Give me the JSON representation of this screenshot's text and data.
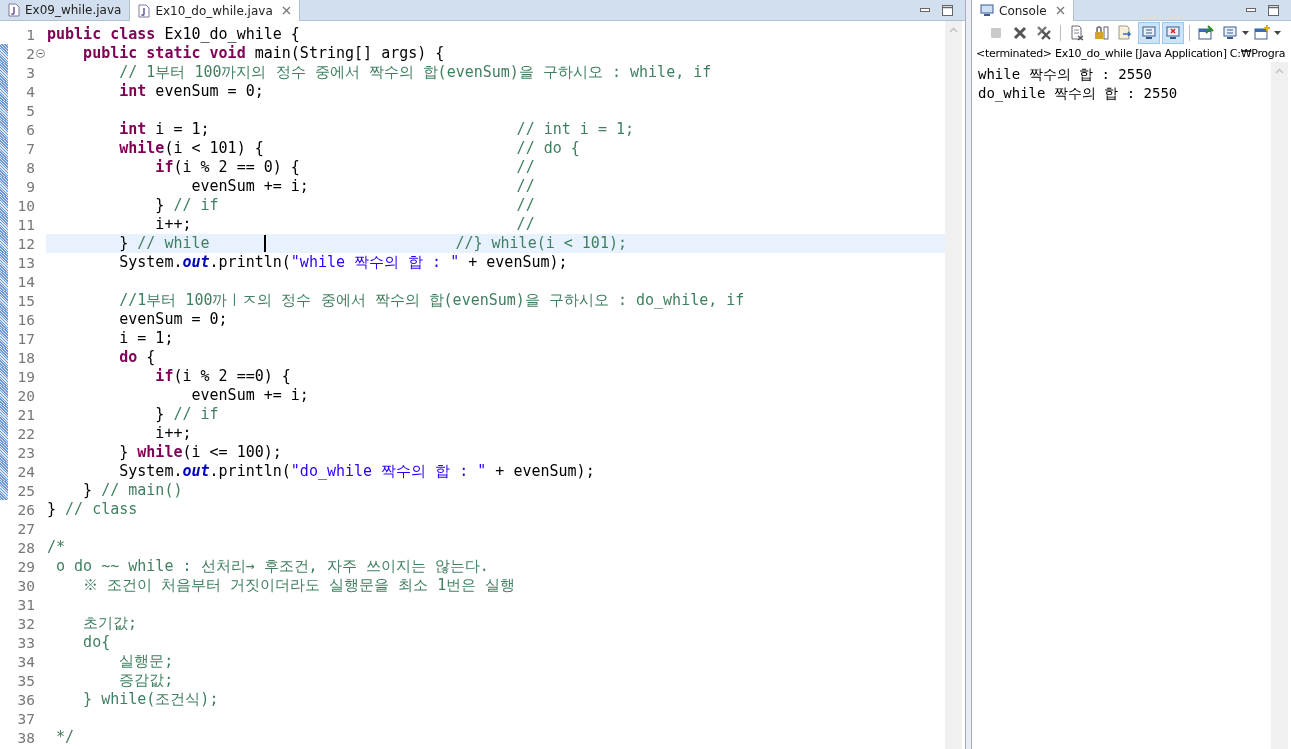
{
  "editor": {
    "tabs": [
      {
        "label": "Ex09_while.java",
        "selected": false,
        "closable": false
      },
      {
        "label": "Ex10_do_while.java",
        "selected": true,
        "closable": true
      }
    ],
    "lines": [
      {
        "number": "1",
        "changed": false,
        "current": false,
        "segments": [
          {
            "kind": "kw",
            "text": "public class"
          },
          {
            "kind": "plain",
            "text": " Ex10_do_while {"
          }
        ]
      },
      {
        "number": "2",
        "changed": true,
        "current": false,
        "foldable": true,
        "segments": [
          {
            "kind": "kw",
            "text": "    public static void"
          },
          {
            "kind": "plain",
            "text": " main(String[] args) {"
          }
        ]
      },
      {
        "number": "3",
        "changed": true,
        "current": false,
        "segments": [
          {
            "kind": "comment",
            "text": "        // 1부터 100까지의 정수 중에서 짝수의 합(evenSum)을 구하시오 : while, if"
          }
        ]
      },
      {
        "number": "4",
        "changed": true,
        "current": false,
        "segments": [
          {
            "kind": "kw",
            "text": "        int"
          },
          {
            "kind": "plain",
            "text": " evenSum = 0;"
          }
        ]
      },
      {
        "number": "5",
        "changed": true,
        "current": false
      },
      {
        "number": "6",
        "changed": true,
        "current": false,
        "segments": [
          {
            "kind": "kw",
            "text": "        int"
          },
          {
            "kind": "plain",
            "text": " i = 1;                                  "
          },
          {
            "kind": "comment",
            "text": "// int i = 1;"
          }
        ]
      },
      {
        "number": "7",
        "changed": true,
        "current": false,
        "segments": [
          {
            "kind": "kw",
            "text": "        while"
          },
          {
            "kind": "plain",
            "text": "(i < 101) {                            "
          },
          {
            "kind": "comment",
            "text": "// do {"
          }
        ]
      },
      {
        "number": "8",
        "changed": true,
        "current": false,
        "segments": [
          {
            "kind": "kw",
            "text": "            if"
          },
          {
            "kind": "plain",
            "text": "(i % 2 == 0) {                        "
          },
          {
            "kind": "comment",
            "text": "//"
          }
        ]
      },
      {
        "number": "9",
        "changed": true,
        "current": false,
        "segments": [
          {
            "kind": "plain",
            "text": "                evenSum += i;                       "
          },
          {
            "kind": "comment",
            "text": "//"
          }
        ]
      },
      {
        "number": "10",
        "changed": true,
        "current": false,
        "segments": [
          {
            "kind": "plain",
            "text": "            } "
          },
          {
            "kind": "comment",
            "text": "// if                                 //"
          }
        ]
      },
      {
        "number": "11",
        "changed": true,
        "current": false,
        "segments": [
          {
            "kind": "plain",
            "text": "            i++;                                    "
          },
          {
            "kind": "comment",
            "text": "//"
          }
        ]
      },
      {
        "number": "12",
        "changed": true,
        "current": true,
        "cursor": true,
        "segments": [
          {
            "kind": "plain",
            "text": "        } "
          },
          {
            "kind": "comment",
            "text": "// while      "
          },
          {
            "kind": "comment",
            "text": "                     //} while(i < 101);"
          }
        ]
      },
      {
        "number": "13",
        "changed": true,
        "current": false,
        "segments": [
          {
            "kind": "plain",
            "text": "        System."
          },
          {
            "kind": "field",
            "text": "out"
          },
          {
            "kind": "plain",
            "text": ".println("
          },
          {
            "kind": "string",
            "text": "\"while 짝수의 합 : \""
          },
          {
            "kind": "plain",
            "text": " + evenSum);"
          }
        ]
      },
      {
        "number": "14",
        "changed": true,
        "current": false
      },
      {
        "number": "15",
        "changed": true,
        "current": false,
        "segments": [
          {
            "kind": "comment",
            "text": "        //1부터 100까ㅣㅈ의 정수 중에서 짝수의 합(evenSum)을 구하시오 : do_while, if"
          }
        ]
      },
      {
        "number": "16",
        "changed": true,
        "current": false,
        "segments": [
          {
            "kind": "plain",
            "text": "        evenSum = 0;"
          }
        ]
      },
      {
        "number": "17",
        "changed": true,
        "current": false,
        "segments": [
          {
            "kind": "plain",
            "text": "        i = 1;"
          }
        ]
      },
      {
        "number": "18",
        "changed": true,
        "current": false,
        "segments": [
          {
            "kind": "kw",
            "text": "        do"
          },
          {
            "kind": "plain",
            "text": " {"
          }
        ]
      },
      {
        "number": "19",
        "changed": true,
        "current": false,
        "segments": [
          {
            "kind": "kw",
            "text": "            if"
          },
          {
            "kind": "plain",
            "text": "(i % 2 ==0) {"
          }
        ]
      },
      {
        "number": "20",
        "changed": true,
        "current": false,
        "segments": [
          {
            "kind": "plain",
            "text": "                evenSum += i;"
          }
        ]
      },
      {
        "number": "21",
        "changed": true,
        "current": false,
        "segments": [
          {
            "kind": "plain",
            "text": "            } "
          },
          {
            "kind": "comment",
            "text": "// if"
          }
        ]
      },
      {
        "number": "22",
        "changed": true,
        "current": false,
        "segments": [
          {
            "kind": "plain",
            "text": "            i++;"
          }
        ]
      },
      {
        "number": "23",
        "changed": true,
        "current": false,
        "segments": [
          {
            "kind": "plain",
            "text": "        } "
          },
          {
            "kind": "kw",
            "text": "while"
          },
          {
            "kind": "plain",
            "text": "(i <= 100);"
          }
        ]
      },
      {
        "number": "24",
        "changed": true,
        "current": false,
        "segments": [
          {
            "kind": "plain",
            "text": "        System."
          },
          {
            "kind": "field",
            "text": "out"
          },
          {
            "kind": "plain",
            "text": ".println("
          },
          {
            "kind": "string",
            "text": "\"do_while 짝수의 합 : \""
          },
          {
            "kind": "plain",
            "text": " + evenSum);"
          }
        ]
      },
      {
        "number": "25",
        "changed": true,
        "current": false,
        "segments": [
          {
            "kind": "plain",
            "text": "    } "
          },
          {
            "kind": "comment",
            "text": "// main()"
          }
        ]
      },
      {
        "number": "26",
        "changed": false,
        "current": false,
        "segments": [
          {
            "kind": "plain",
            "text": "} "
          },
          {
            "kind": "comment",
            "text": "// class"
          }
        ]
      },
      {
        "number": "27",
        "changed": false,
        "current": false
      },
      {
        "number": "28",
        "changed": false,
        "current": false,
        "segments": [
          {
            "kind": "comment",
            "text": "/*"
          }
        ]
      },
      {
        "number": "29",
        "changed": false,
        "current": false,
        "segments": [
          {
            "kind": "comment",
            "text": " o do ~~ while : 선처리→ 후조건, 자주 쓰이지는 않는다."
          }
        ]
      },
      {
        "number": "30",
        "changed": false,
        "current": false,
        "segments": [
          {
            "kind": "comment",
            "text": "    ※ 조건이 처음부터 거짓이더라도 실행문을 최소 1번은 실행"
          }
        ]
      },
      {
        "number": "31",
        "changed": false,
        "current": false
      },
      {
        "number": "32",
        "changed": false,
        "current": false,
        "segments": [
          {
            "kind": "comment",
            "text": "    초기값;"
          }
        ]
      },
      {
        "number": "33",
        "changed": false,
        "current": false,
        "segments": [
          {
            "kind": "comment",
            "text": "    do{"
          }
        ]
      },
      {
        "number": "34",
        "changed": false,
        "current": false,
        "segments": [
          {
            "kind": "comment",
            "text": "        실행문;"
          }
        ]
      },
      {
        "number": "35",
        "changed": false,
        "current": false,
        "segments": [
          {
            "kind": "comment",
            "text": "        증감값;"
          }
        ]
      },
      {
        "number": "36",
        "changed": false,
        "current": false,
        "segments": [
          {
            "kind": "comment",
            "text": "    } while(조건식);"
          }
        ]
      },
      {
        "number": "37",
        "changed": false,
        "current": false
      },
      {
        "number": "38",
        "changed": false,
        "current": false,
        "segments": [
          {
            "kind": "comment",
            "text": " */"
          }
        ]
      }
    ]
  },
  "console": {
    "tab": {
      "label": "Console",
      "selected": true
    },
    "toolbar": [
      {
        "kind": "terminate",
        "on": false,
        "disabled": true
      },
      {
        "kind": "remove",
        "on": false,
        "disabled": false
      },
      {
        "kind": "remove-all",
        "on": false,
        "disabled": false
      },
      {
        "kind": "clear",
        "on": false,
        "disabled": false
      },
      {
        "kind": "scroll-lock",
        "on": false,
        "disabled": false
      },
      {
        "kind": "word-wrap",
        "on": false,
        "disabled": false
      },
      {
        "kind": "show-stdout",
        "on": true,
        "disabled": false
      },
      {
        "kind": "show-stderr",
        "on": true,
        "disabled": false
      },
      {
        "kind": "pin",
        "on": false,
        "disabled": false
      },
      {
        "kind": "display",
        "on": false,
        "disabled": false
      },
      {
        "kind": "new-console",
        "on": false,
        "disabled": false
      }
    ],
    "status": "<terminated> Ex10_do_while [Java Application] C:₩Progra",
    "output": [
      "while 짝수의 합 : 2550",
      "do_while 짝수의 합 : 2550"
    ]
  }
}
